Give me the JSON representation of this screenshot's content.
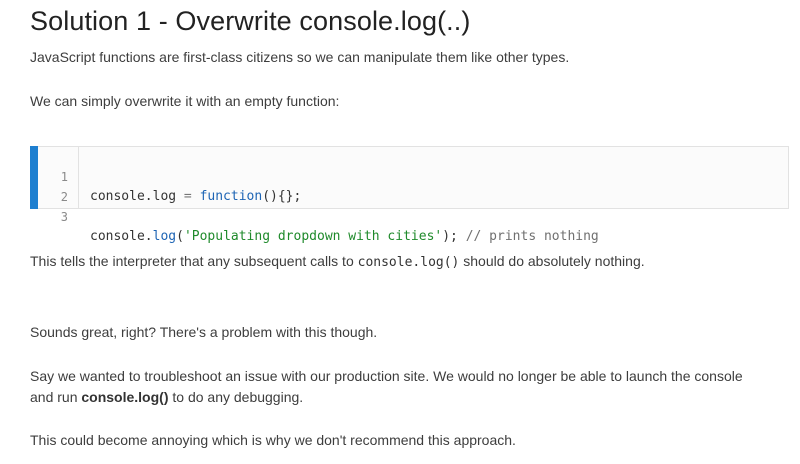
{
  "title": "Solution 1 - Overwrite console.log(..)",
  "paragraphs": {
    "p1": "JavaScript functions are first-class citizens so we can manipulate them like other types.",
    "p2": "We can simply overwrite it with an empty function:",
    "p3_before": "This tells the interpreter that any subsequent calls to ",
    "p3_code": "console.log()",
    "p3_after": " should do absolutely nothing.",
    "p4": "Sounds great, right?  There's a problem with this though.",
    "p5_line1": "Say we wanted to troubleshoot an issue with our production site.  We would no longer be able to launch the console",
    "p5_line2_before": "and run ",
    "p5_line2_bold": "console.log()",
    "p5_line2_after": " to do any debugging.",
    "p6": "This could become annoying which is why we don't recommend this approach."
  },
  "code": {
    "lines": [
      {
        "number": "1",
        "a": "console.log ",
        "b": "=",
        "c": " ",
        "fn": "function",
        "d": "(){};"
      },
      {
        "number": "2"
      },
      {
        "number": "3",
        "a": "console.",
        "fn": "log",
        "b": "(",
        "str": "'Populating dropdown with cities'",
        "c": "); ",
        "cmt": "// prints nothing"
      }
    ]
  },
  "colors": {
    "accent_bar": "#1e7fd0",
    "function_keyword": "#1d64b4",
    "string": "#1f8a2b",
    "comment": "#707070"
  }
}
